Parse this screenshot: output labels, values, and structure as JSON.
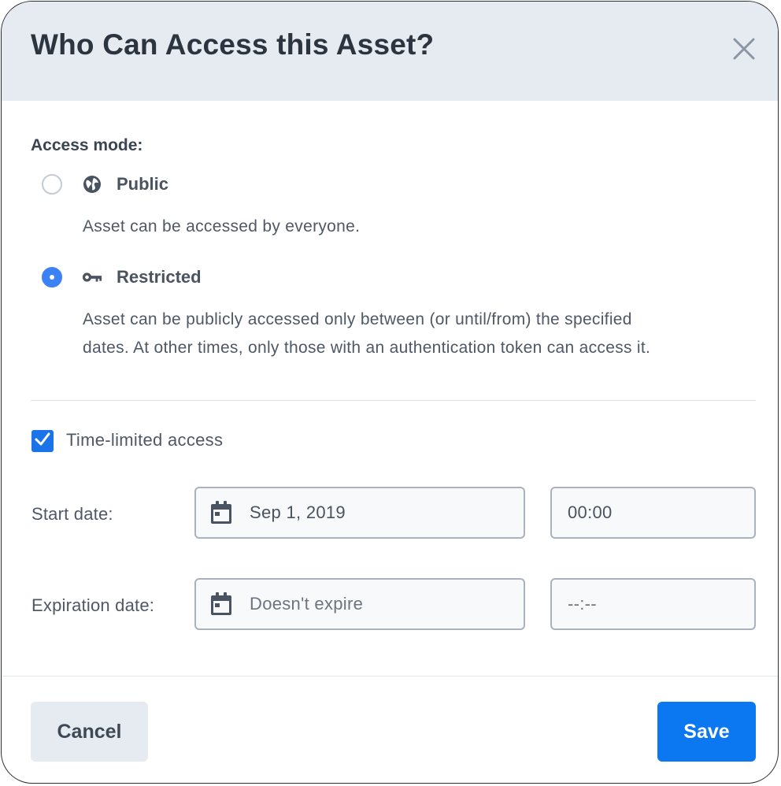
{
  "dialog": {
    "title": "Who Can Access this Asset?",
    "close_icon": "close-icon"
  },
  "access_mode": {
    "label": "Access mode:",
    "options": [
      {
        "label": "Public",
        "icon": "globe-icon",
        "description": "Asset can be accessed by everyone.",
        "selected": false
      },
      {
        "label": "Restricted",
        "icon": "key-icon",
        "description_line1": "Asset can be publicly accessed only between (or until/from) the specified",
        "description_line2": "dates. At other times, only those with an authentication token can access it.",
        "selected": true
      }
    ]
  },
  "time_limit": {
    "label": "Time-limited access",
    "checked": true
  },
  "start": {
    "label": "Start date:",
    "date_value": "Sep 1, 2019",
    "time_value": "00:00"
  },
  "expiration": {
    "label": "Expiration date:",
    "date_placeholder": "Doesn't expire",
    "time_placeholder": "--:--"
  },
  "buttons": {
    "cancel": "Cancel",
    "save": "Save"
  },
  "colors": {
    "accent": "#0b77f0",
    "header_bg": "#e5ebf1"
  }
}
